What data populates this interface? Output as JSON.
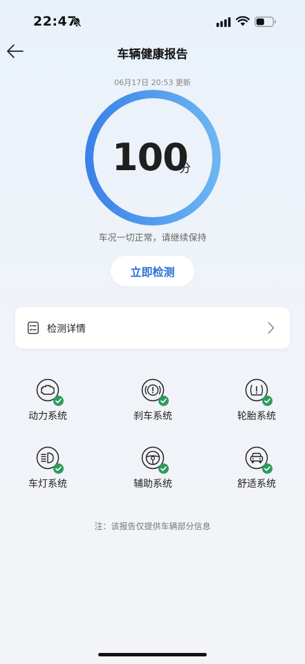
{
  "status_bar": {
    "time": "22:47",
    "icons": [
      "bell-off-icon",
      "signal-icon",
      "wifi-icon",
      "battery-icon"
    ]
  },
  "nav": {
    "title": "车辆健康报告",
    "back_icon": "arrow-left-icon"
  },
  "report": {
    "updated": "06月17日 20:53 更新",
    "score": "100",
    "score_unit": "分",
    "score_progress": 1.0,
    "message": "车况一切正常，请继续保持",
    "check_button": "立即检测"
  },
  "detail": {
    "label": "检测详情",
    "icon": "checklist-icon"
  },
  "systems": [
    {
      "label": "动力系统",
      "icon": "engine-icon",
      "status": "ok"
    },
    {
      "label": "刹车系统",
      "icon": "brake-icon",
      "status": "ok"
    },
    {
      "label": "轮胎系统",
      "icon": "tire-warning-icon",
      "status": "ok"
    },
    {
      "label": "车灯系统",
      "icon": "headlight-icon",
      "status": "ok"
    },
    {
      "label": "辅助系统",
      "icon": "steering-wheel-icon",
      "status": "ok"
    },
    {
      "label": "舒适系统",
      "icon": "car-front-icon",
      "status": "ok"
    }
  ],
  "footnote": "注：该报告仅提供车辆部分信息",
  "colors": {
    "accent": "#2e6fd6",
    "ring_start": "#3a82e8",
    "ring_end": "#69b1f0",
    "ok_badge": "#2f9a5e"
  }
}
